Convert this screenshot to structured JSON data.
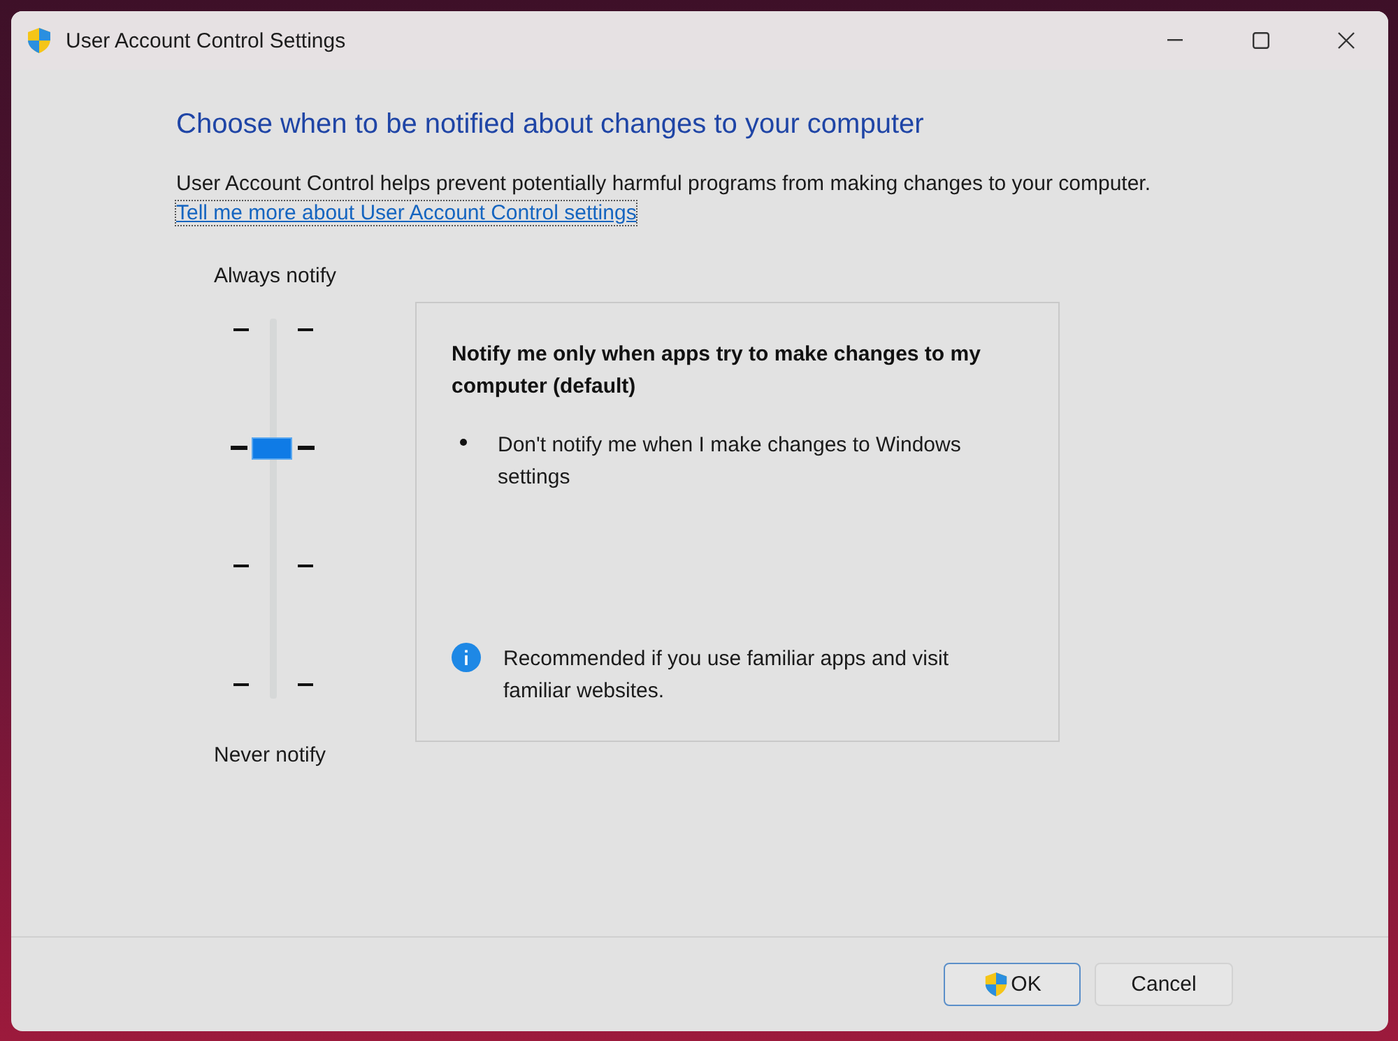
{
  "window": {
    "title": "User Account Control Settings"
  },
  "heading": "Choose when to be notified about changes to your computer",
  "description": "User Account Control helps prevent potentially harmful programs from making changes to your computer.",
  "link": "Tell me more about User Account Control settings",
  "slider": {
    "top_label": "Always notify",
    "bottom_label": "Never notify",
    "level": 0.667
  },
  "panel": {
    "title": "Notify me only when apps try to make changes to my computer (default)",
    "bullets": [
      "Don't notify me when I make changes to Windows settings"
    ],
    "note": "Recommended if you use familiar apps and visit familiar websites."
  },
  "buttons": [
    {
      "label": "OK",
      "default": true,
      "shield": true
    },
    {
      "label": "Cancel",
      "default": false,
      "shield": false
    }
  ]
}
